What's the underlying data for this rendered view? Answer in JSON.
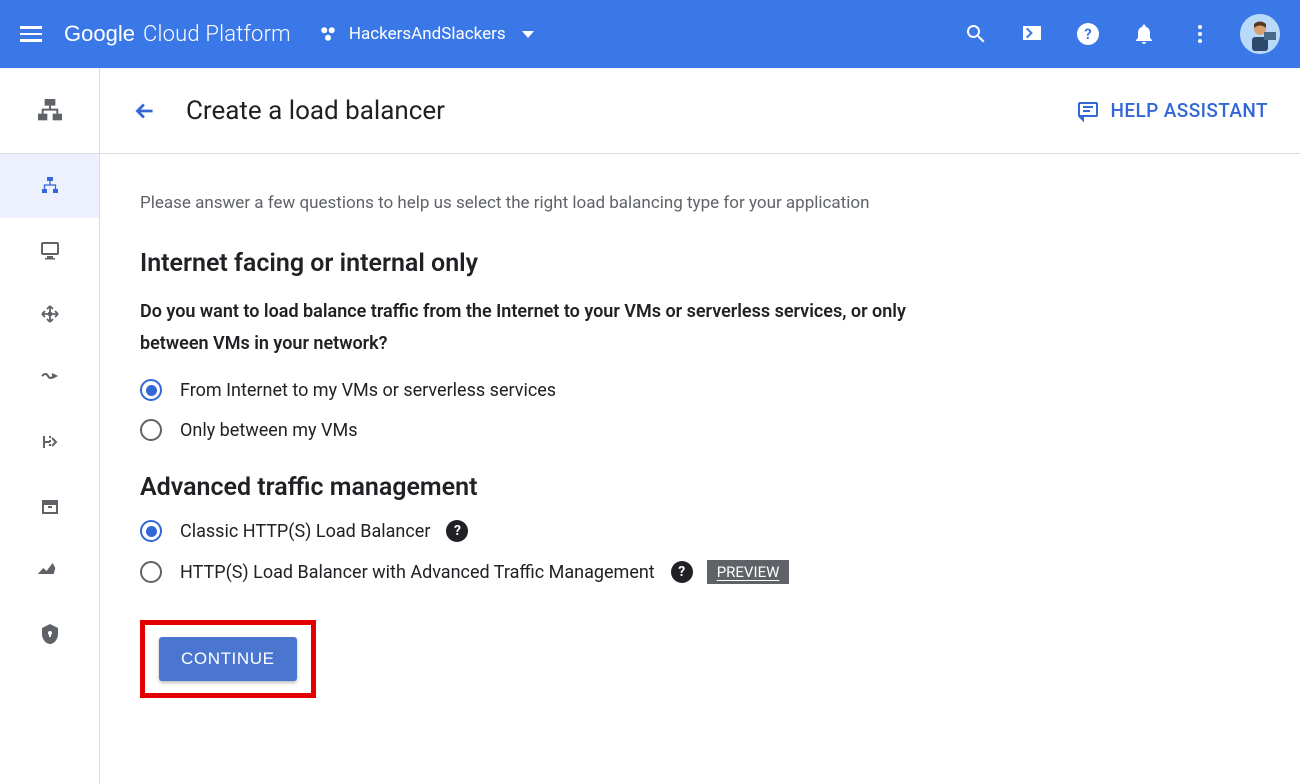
{
  "header": {
    "logo_google": "Google",
    "logo_rest": "Cloud Platform",
    "project_name": "HackersAndSlackers"
  },
  "page": {
    "title": "Create a load balancer",
    "help_assistant_label": "HELP ASSISTANT"
  },
  "content": {
    "intro": "Please answer a few questions to help us select the right load balancing type for your application",
    "section1": {
      "title": "Internet facing or internal only",
      "question": "Do you want to load balance traffic from the Internet to your VMs or serverless services, or only between VMs in your network?",
      "options": [
        {
          "label": "From Internet to my VMs or serverless services",
          "checked": true
        },
        {
          "label": "Only between my VMs",
          "checked": false
        }
      ]
    },
    "section2": {
      "title": "Advanced traffic management",
      "options": [
        {
          "label": "Classic HTTP(S) Load Balancer",
          "checked": true,
          "help": true,
          "preview": false
        },
        {
          "label": "HTTP(S) Load Balancer with Advanced Traffic Management",
          "checked": false,
          "help": true,
          "preview": true
        }
      ],
      "preview_badge": "PREVIEW"
    },
    "continue_label": "CONTINUE"
  }
}
